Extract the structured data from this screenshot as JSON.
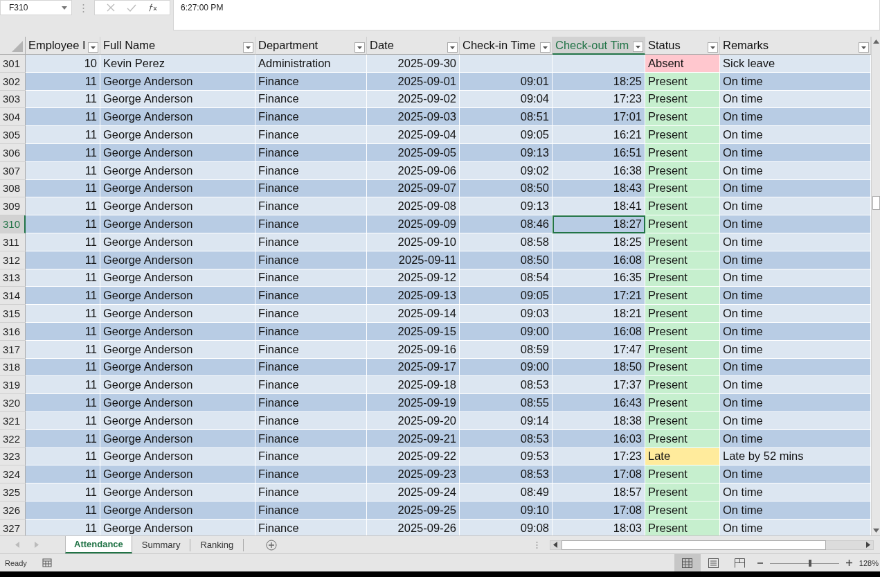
{
  "formula_bar": {
    "name_box": "F310",
    "formula": "6:27:00 PM"
  },
  "columns": [
    {
      "label": "Employee I",
      "selected": false
    },
    {
      "label": "Full Name",
      "selected": false
    },
    {
      "label": "Department",
      "selected": false
    },
    {
      "label": "Date",
      "selected": false
    },
    {
      "label": "Check-in Time",
      "selected": false
    },
    {
      "label": "Check-out Tim",
      "selected": true
    },
    {
      "label": "Status",
      "selected": false
    },
    {
      "label": "Remarks",
      "selected": false
    }
  ],
  "rows": [
    {
      "row": "301",
      "cells": [
        "10",
        "Kevin Perez",
        "Administration",
        "2025-09-30",
        "",
        "",
        "Absent",
        "Sick leave"
      ],
      "color": "#ffc7ce",
      "selected": false
    },
    {
      "row": "302",
      "cells": [
        "11",
        "George Anderson",
        "Finance",
        "2025-09-01",
        "09:01",
        "18:25",
        "Present",
        "On time"
      ],
      "color": "#c6efce",
      "selected": false
    },
    {
      "row": "303",
      "cells": [
        "11",
        "George Anderson",
        "Finance",
        "2025-09-02",
        "09:04",
        "17:23",
        "Present",
        "On time"
      ],
      "color": "#c6efce",
      "selected": false
    },
    {
      "row": "304",
      "cells": [
        "11",
        "George Anderson",
        "Finance",
        "2025-09-03",
        "08:51",
        "17:01",
        "Present",
        "On time"
      ],
      "color": "#c6efce",
      "selected": false
    },
    {
      "row": "305",
      "cells": [
        "11",
        "George Anderson",
        "Finance",
        "2025-09-04",
        "09:05",
        "16:21",
        "Present",
        "On time"
      ],
      "color": "#c6efce",
      "selected": false
    },
    {
      "row": "306",
      "cells": [
        "11",
        "George Anderson",
        "Finance",
        "2025-09-05",
        "09:13",
        "16:51",
        "Present",
        "On time"
      ],
      "color": "#c6efce",
      "selected": false
    },
    {
      "row": "307",
      "cells": [
        "11",
        "George Anderson",
        "Finance",
        "2025-09-06",
        "09:02",
        "16:38",
        "Present",
        "On time"
      ],
      "color": "#c6efce",
      "selected": false
    },
    {
      "row": "308",
      "cells": [
        "11",
        "George Anderson",
        "Finance",
        "2025-09-07",
        "08:50",
        "18:43",
        "Present",
        "On time"
      ],
      "color": "#c6efce",
      "selected": false
    },
    {
      "row": "309",
      "cells": [
        "11",
        "George Anderson",
        "Finance",
        "2025-09-08",
        "09:13",
        "18:41",
        "Present",
        "On time"
      ],
      "color": "#c6efce",
      "selected": false
    },
    {
      "row": "310",
      "cells": [
        "11",
        "George Anderson",
        "Finance",
        "2025-09-09",
        "08:46",
        "18:27",
        "Present",
        "On time"
      ],
      "color": "#c6efce",
      "selected": true
    },
    {
      "row": "311",
      "cells": [
        "11",
        "George Anderson",
        "Finance",
        "2025-09-10",
        "08:58",
        "18:25",
        "Present",
        "On time"
      ],
      "color": "#c6efce",
      "selected": false
    },
    {
      "row": "312",
      "cells": [
        "11",
        "George Anderson",
        "Finance",
        "2025-09-11",
        "08:50",
        "16:08",
        "Present",
        "On time"
      ],
      "color": "#c6efce",
      "selected": false
    },
    {
      "row": "313",
      "cells": [
        "11",
        "George Anderson",
        "Finance",
        "2025-09-12",
        "08:54",
        "16:35",
        "Present",
        "On time"
      ],
      "color": "#c6efce",
      "selected": false
    },
    {
      "row": "314",
      "cells": [
        "11",
        "George Anderson",
        "Finance",
        "2025-09-13",
        "09:05",
        "17:21",
        "Present",
        "On time"
      ],
      "color": "#c6efce",
      "selected": false
    },
    {
      "row": "315",
      "cells": [
        "11",
        "George Anderson",
        "Finance",
        "2025-09-14",
        "09:03",
        "18:21",
        "Present",
        "On time"
      ],
      "color": "#c6efce",
      "selected": false
    },
    {
      "row": "316",
      "cells": [
        "11",
        "George Anderson",
        "Finance",
        "2025-09-15",
        "09:00",
        "16:08",
        "Present",
        "On time"
      ],
      "color": "#c6efce",
      "selected": false
    },
    {
      "row": "317",
      "cells": [
        "11",
        "George Anderson",
        "Finance",
        "2025-09-16",
        "08:59",
        "17:47",
        "Present",
        "On time"
      ],
      "color": "#c6efce",
      "selected": false
    },
    {
      "row": "318",
      "cells": [
        "11",
        "George Anderson",
        "Finance",
        "2025-09-17",
        "09:00",
        "18:50",
        "Present",
        "On time"
      ],
      "color": "#c6efce",
      "selected": false
    },
    {
      "row": "319",
      "cells": [
        "11",
        "George Anderson",
        "Finance",
        "2025-09-18",
        "08:53",
        "17:37",
        "Present",
        "On time"
      ],
      "color": "#c6efce",
      "selected": false
    },
    {
      "row": "320",
      "cells": [
        "11",
        "George Anderson",
        "Finance",
        "2025-09-19",
        "08:55",
        "16:43",
        "Present",
        "On time"
      ],
      "color": "#c6efce",
      "selected": false
    },
    {
      "row": "321",
      "cells": [
        "11",
        "George Anderson",
        "Finance",
        "2025-09-20",
        "09:14",
        "18:38",
        "Present",
        "On time"
      ],
      "color": "#c6efce",
      "selected": false
    },
    {
      "row": "322",
      "cells": [
        "11",
        "George Anderson",
        "Finance",
        "2025-09-21",
        "08:53",
        "16:03",
        "Present",
        "On time"
      ],
      "color": "#c6efce",
      "selected": false
    },
    {
      "row": "323",
      "cells": [
        "11",
        "George Anderson",
        "Finance",
        "2025-09-22",
        "09:53",
        "17:23",
        "Late",
        "Late by 52 mins"
      ],
      "color": "#ffeb9c",
      "selected": false
    },
    {
      "row": "324",
      "cells": [
        "11",
        "George Anderson",
        "Finance",
        "2025-09-23",
        "08:53",
        "17:08",
        "Present",
        "On time"
      ],
      "color": "#c6efce",
      "selected": false
    },
    {
      "row": "325",
      "cells": [
        "11",
        "George Anderson",
        "Finance",
        "2025-09-24",
        "08:49",
        "18:57",
        "Present",
        "On time"
      ],
      "color": "#c6efce",
      "selected": false
    },
    {
      "row": "326",
      "cells": [
        "11",
        "George Anderson",
        "Finance",
        "2025-09-25",
        "09:10",
        "17:08",
        "Present",
        "On time"
      ],
      "color": "#c6efce",
      "selected": false
    },
    {
      "row": "327",
      "cells": [
        "11",
        "George Anderson",
        "Finance",
        "2025-09-26",
        "09:08",
        "18:03",
        "Present",
        "On time"
      ],
      "color": "#c6efce",
      "selected": false
    }
  ],
  "sheet_tabs": [
    {
      "label": "Attendance",
      "selected": true
    },
    {
      "label": "Summary",
      "selected": false
    },
    {
      "label": "Ranking",
      "selected": false
    }
  ],
  "status_bar": {
    "status": "Ready",
    "zoom": {
      "level": 0.58,
      "reading": "128%"
    }
  }
}
